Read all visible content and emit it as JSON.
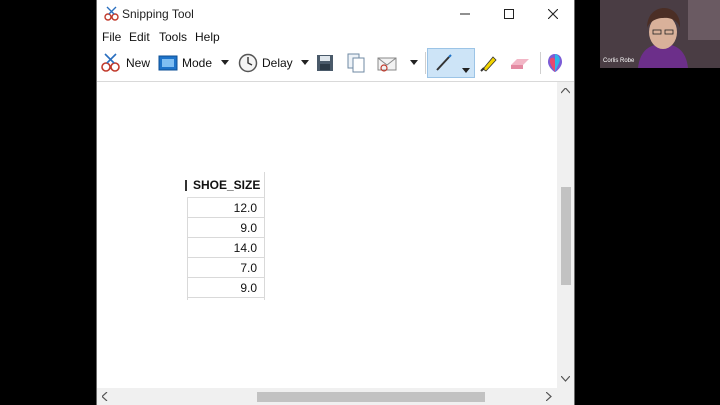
{
  "window": {
    "title": "Snipping Tool"
  },
  "menu": [
    "File",
    "Edit",
    "Tools",
    "Help"
  ],
  "toolbar": {
    "new_label": "New",
    "mode_label": "Mode",
    "delay_label": "Delay"
  },
  "table": {
    "header": "SHOE_SIZE",
    "values": [
      "12.0",
      "9.0",
      "14.0",
      "7.0",
      "9.0"
    ]
  },
  "webcam": {
    "name": "Corlis Robe"
  },
  "colors": {
    "accent": "#cde4f7",
    "scrollbar": "#f0f0f0",
    "background": "#000000"
  }
}
